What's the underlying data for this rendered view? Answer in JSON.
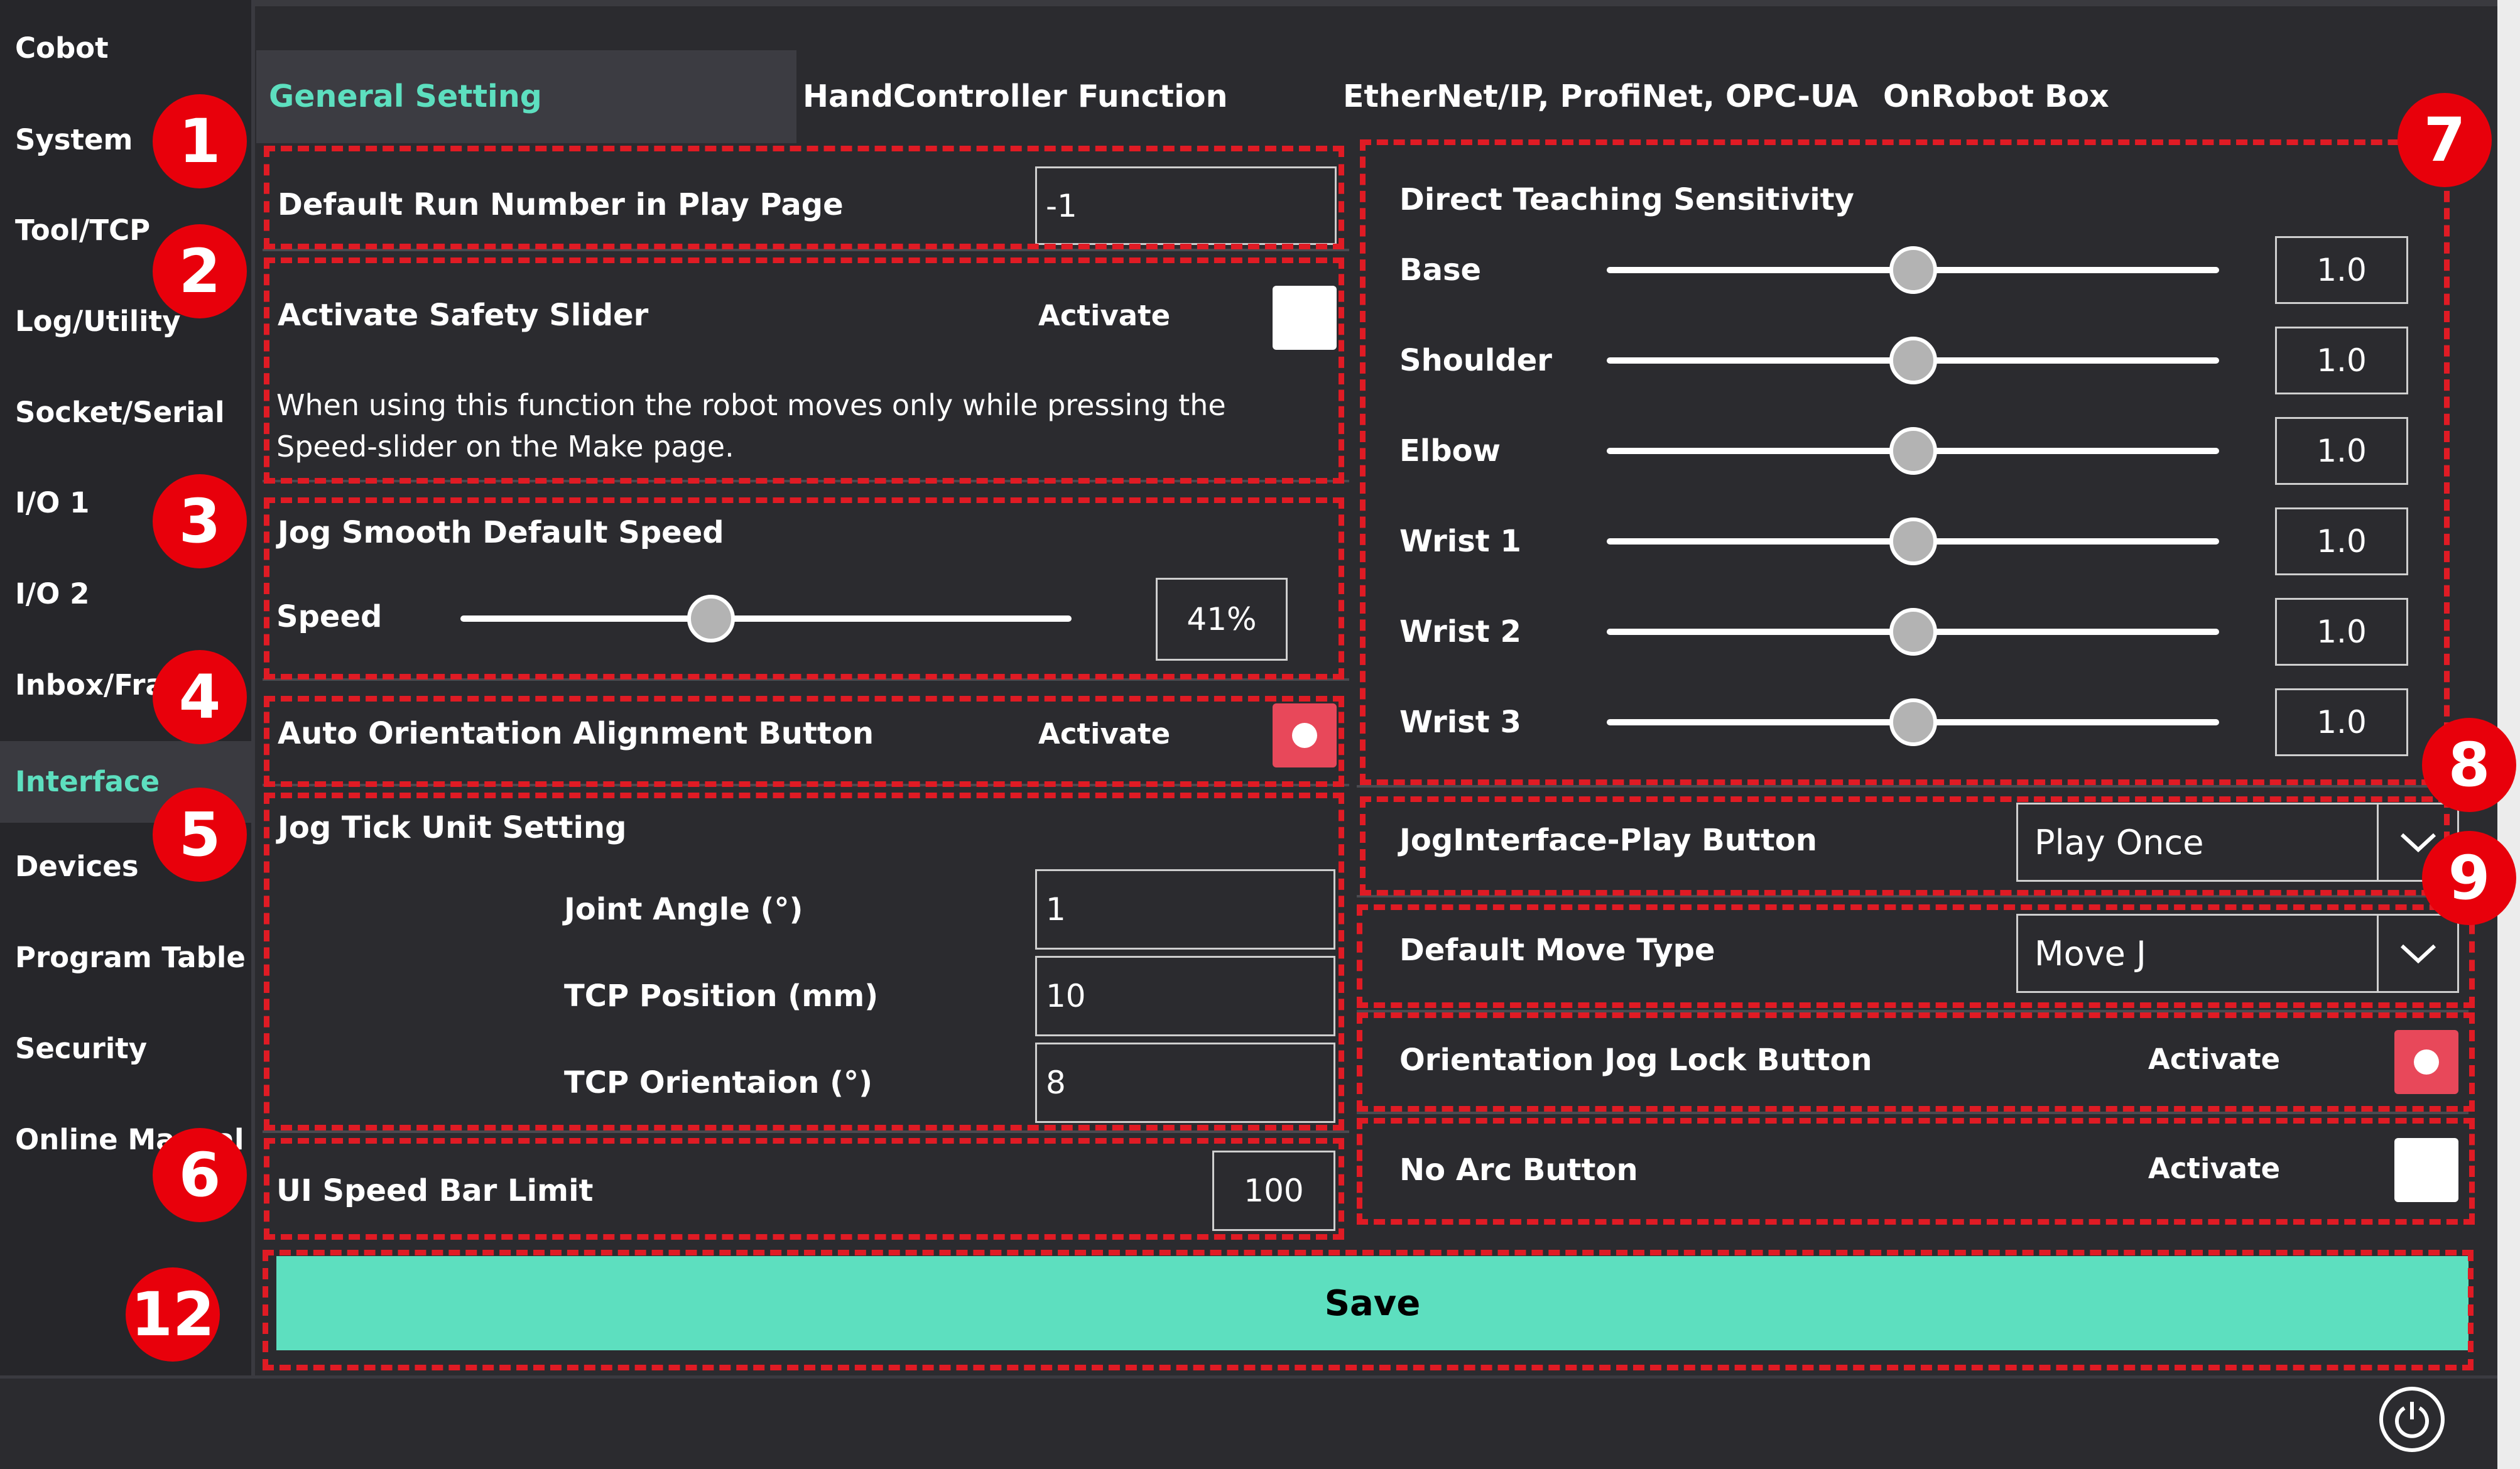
{
  "sidebar": {
    "items": [
      {
        "label": "Cobot"
      },
      {
        "label": "System"
      },
      {
        "label": "Tool/TCP"
      },
      {
        "label": "Log/Utility"
      },
      {
        "label": "Socket/Serial"
      },
      {
        "label": "I/O 1"
      },
      {
        "label": "I/O 2"
      },
      {
        "label": "Inbox/Frame"
      },
      {
        "label": "Interface"
      },
      {
        "label": "Devices"
      },
      {
        "label": "Program Table"
      },
      {
        "label": "Security"
      },
      {
        "label": "Online Manual"
      }
    ],
    "active": "Interface"
  },
  "tabs": [
    {
      "label": "General Setting"
    },
    {
      "label": "HandController Function"
    },
    {
      "label": "EtherNet/IP, ProfiNet, OPC-UA"
    },
    {
      "label": "OnRobot Box"
    }
  ],
  "general": {
    "default_run_number": {
      "label": "Default Run Number in Play Page",
      "value": "-1"
    },
    "safety_slider": {
      "label": "Activate Safety Slider",
      "activate_label": "Activate",
      "checked": false,
      "description": "When using this function the robot moves only while pressing the Speed-slider on the Make page."
    },
    "jog_smooth": {
      "label": "Jog Smooth Default Speed",
      "speed_label": "Speed",
      "value": "41%",
      "level": 0.41
    },
    "auto_orientation": {
      "label": "Auto Orientation Alignment Button",
      "activate_label": "Activate",
      "checked": true
    },
    "jog_tick": {
      "label": "Jog Tick Unit Setting",
      "joint_angle": {
        "label": "Joint Angle (°)",
        "value": "1"
      },
      "tcp_position": {
        "label": "TCP Position (mm)",
        "value": "10"
      },
      "tcp_orientation": {
        "label": "TCP Orientaion (°)",
        "value": "8"
      }
    },
    "ui_speed_bar": {
      "label": "UI Speed Bar Limit",
      "value": "100"
    },
    "direct_teaching": {
      "label": "Direct Teaching Sensitivity",
      "joints": [
        {
          "label": "Base",
          "value": "1.0",
          "level": 0.5
        },
        {
          "label": "Shoulder",
          "value": "1.0",
          "level": 0.5
        },
        {
          "label": "Elbow",
          "value": "1.0",
          "level": 0.5
        },
        {
          "label": "Wrist 1",
          "value": "1.0",
          "level": 0.5
        },
        {
          "label": "Wrist 2",
          "value": "1.0",
          "level": 0.5
        },
        {
          "label": "Wrist 3",
          "value": "1.0",
          "level": 0.5
        }
      ]
    },
    "jog_play_button": {
      "label": "JogInterface-Play Button",
      "value": "Play Once"
    },
    "default_move_type": {
      "label": "Default Move Type",
      "value": "Move J"
    },
    "orientation_jog_lock": {
      "label": "Orientation Jog Lock Button",
      "activate_label": "Activate",
      "checked": true
    },
    "no_arc": {
      "label": "No Arc Button",
      "activate_label": "Activate",
      "checked": false
    }
  },
  "save_label": "Save",
  "callouts": [
    "1",
    "2",
    "3",
    "4",
    "5",
    "6",
    "7",
    "8",
    "9",
    "12"
  ],
  "colors": {
    "accent": "#5ddfbf",
    "checked": "#e8485a",
    "callout": "#e8000b",
    "background": "#2b2b2f"
  }
}
